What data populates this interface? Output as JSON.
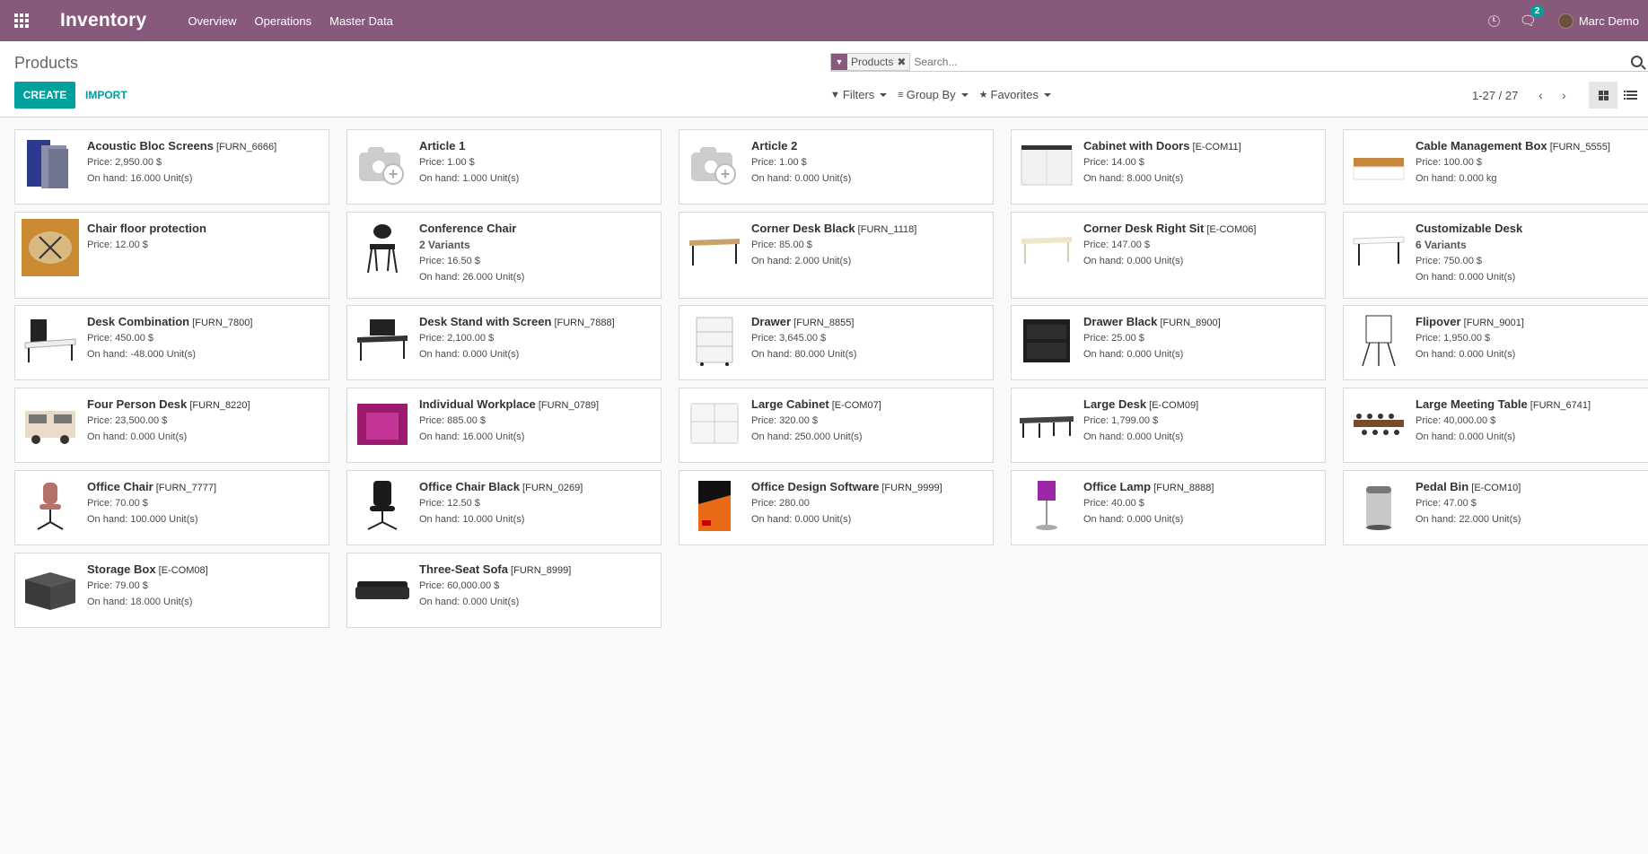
{
  "navbar": {
    "app_title": "Inventory",
    "menu": [
      "Overview",
      "Operations",
      "Master Data"
    ],
    "chat_badge": "2",
    "user_name": "Marc Demo"
  },
  "control": {
    "page_title": "Products",
    "create_label": "CREATE",
    "import_label": "IMPORT",
    "search_facet": "Products",
    "search_placeholder": "Search...",
    "filters_label": "Filters",
    "group_by_label": "Group By",
    "favorites_label": "Favorites",
    "pager": "1-27 / 27"
  },
  "colors": {
    "brand": "#875a7b",
    "accent": "#00a09d"
  },
  "products": [
    {
      "name": "Acoustic Bloc Screens",
      "code": "[FURN_6666]",
      "variants": "",
      "price": "Price: 2,950.00 $",
      "onhand": "On hand: 16.000 Unit(s)",
      "img": "screens"
    },
    {
      "name": "Article 1",
      "code": "",
      "variants": "",
      "price": "Price: 1.00 $",
      "onhand": "On hand: 1.000 Unit(s)",
      "img": "placeholder"
    },
    {
      "name": "Article 2",
      "code": "",
      "variants": "",
      "price": "Price: 1.00 $",
      "onhand": "On hand: 0.000 Unit(s)",
      "img": "placeholder"
    },
    {
      "name": "Cabinet with Doors",
      "code": "[E-COM11]",
      "variants": "",
      "price": "Price: 14.00 $",
      "onhand": "On hand: 8.000 Unit(s)",
      "img": "cabinet-white"
    },
    {
      "name": "Cable Management Box",
      "code": "[FURN_5555]",
      "variants": "",
      "price": "Price: 100.00 $",
      "onhand": "On hand: 0.000 kg",
      "img": "cable-box"
    },
    {
      "name": "Chair floor protection",
      "code": "",
      "variants": "",
      "price": "Price: 12.00 $",
      "onhand": "",
      "img": "floor"
    },
    {
      "name": "Conference Chair",
      "code": "",
      "variants": "2 Variants",
      "price": "Price: 16.50 $",
      "onhand": "On hand: 26.000 Unit(s)",
      "img": "conf-chair"
    },
    {
      "name": "Corner Desk Black",
      "code": "[FURN_1118]",
      "variants": "",
      "price": "Price: 85.00 $",
      "onhand": "On hand: 2.000 Unit(s)",
      "img": "desk-wood"
    },
    {
      "name": "Corner Desk Right Sit",
      "code": "[E-COM06]",
      "variants": "",
      "price": "Price: 147.00 $",
      "onhand": "On hand: 0.000 Unit(s)",
      "img": "desk-light"
    },
    {
      "name": "Customizable Desk",
      "code": "",
      "variants": "6 Variants",
      "price": "Price: 750.00 $",
      "onhand": "On hand: 0.000 Unit(s)",
      "img": "desk-white"
    },
    {
      "name": "Desk Combination",
      "code": "[FURN_7800]",
      "variants": "",
      "price": "Price: 450.00 $",
      "onhand": "On hand: -48.000 Unit(s)",
      "img": "desk-combo"
    },
    {
      "name": "Desk Stand with Screen",
      "code": "[FURN_7888]",
      "variants": "",
      "price": "Price: 2,100.00 $",
      "onhand": "On hand: 0.000 Unit(s)",
      "img": "desk-screen"
    },
    {
      "name": "Drawer",
      "code": "[FURN_8855]",
      "variants": "",
      "price": "Price: 3,645.00 $",
      "onhand": "On hand: 80.000 Unit(s)",
      "img": "drawer-white"
    },
    {
      "name": "Drawer Black",
      "code": "[FURN_8900]",
      "variants": "",
      "price": "Price: 25.00 $",
      "onhand": "On hand: 0.000 Unit(s)",
      "img": "drawer-black"
    },
    {
      "name": "Flipover",
      "code": "[FURN_9001]",
      "variants": "",
      "price": "Price: 1,950.00 $",
      "onhand": "On hand: 0.000 Unit(s)",
      "img": "flipover"
    },
    {
      "name": "Four Person Desk",
      "code": "[FURN_8220]",
      "variants": "",
      "price": "Price: 23,500.00 $",
      "onhand": "On hand: 0.000 Unit(s)",
      "img": "four-desk"
    },
    {
      "name": "Individual Workplace",
      "code": "[FURN_0789]",
      "variants": "",
      "price": "Price: 885.00 $",
      "onhand": "On hand: 16.000 Unit(s)",
      "img": "workplace"
    },
    {
      "name": "Large Cabinet",
      "code": "[E-COM07]",
      "variants": "",
      "price": "Price: 320.00 $",
      "onhand": "On hand: 250.000 Unit(s)",
      "img": "large-cabinet"
    },
    {
      "name": "Large Desk",
      "code": "[E-COM09]",
      "variants": "",
      "price": "Price: 1,799.00 $",
      "onhand": "On hand: 0.000 Unit(s)",
      "img": "large-desk"
    },
    {
      "name": "Large Meeting Table",
      "code": "[FURN_6741]",
      "variants": "",
      "price": "Price: 40,000.00 $",
      "onhand": "On hand: 0.000 Unit(s)",
      "img": "meeting-table"
    },
    {
      "name": "Office Chair",
      "code": "[FURN_7777]",
      "variants": "",
      "price": "Price: 70.00 $",
      "onhand": "On hand: 100.000 Unit(s)",
      "img": "office-chair"
    },
    {
      "name": "Office Chair Black",
      "code": "[FURN_0269]",
      "variants": "",
      "price": "Price: 12.50 $",
      "onhand": "On hand: 10.000 Unit(s)",
      "img": "chair-black"
    },
    {
      "name": "Office Design Software",
      "code": "[FURN_9999]",
      "variants": "",
      "price": "Price: 280.00",
      "onhand": "On hand: 0.000 Unit(s)",
      "img": "software"
    },
    {
      "name": "Office Lamp",
      "code": "[FURN_8888]",
      "variants": "",
      "price": "Price: 40.00 $",
      "onhand": "On hand: 0.000 Unit(s)",
      "img": "lamp"
    },
    {
      "name": "Pedal Bin",
      "code": "[E-COM10]",
      "variants": "",
      "price": "Price: 47.00 $",
      "onhand": "On hand: 22.000 Unit(s)",
      "img": "bin"
    },
    {
      "name": "Storage Box",
      "code": "[E-COM08]",
      "variants": "",
      "price": "Price: 79.00 $",
      "onhand": "On hand: 18.000 Unit(s)",
      "img": "storage-box"
    },
    {
      "name": "Three-Seat Sofa",
      "code": "[FURN_8999]",
      "variants": "",
      "price": "Price: 60,000.00 $",
      "onhand": "On hand: 0.000 Unit(s)",
      "img": "sofa"
    }
  ]
}
